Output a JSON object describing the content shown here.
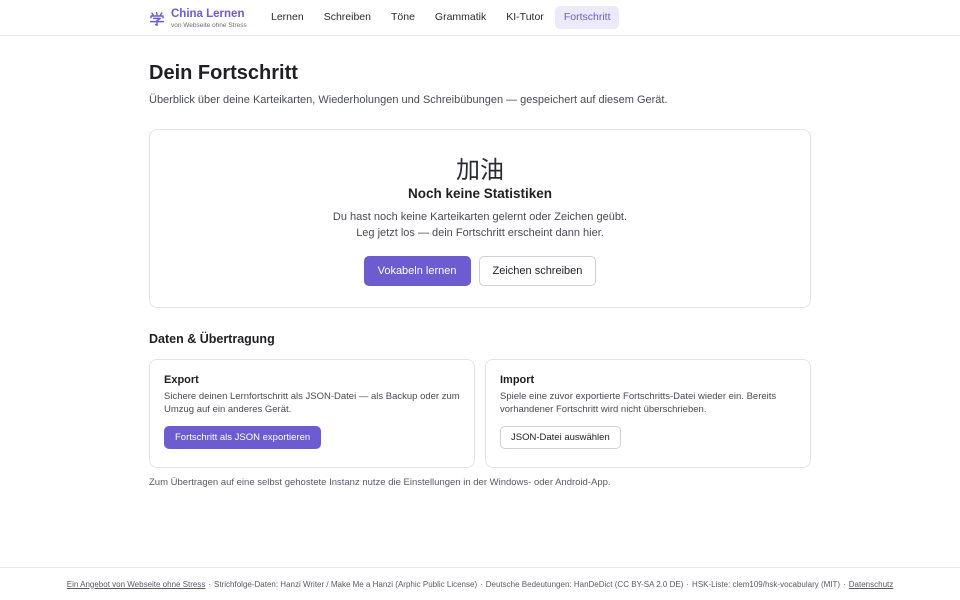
{
  "brand": {
    "icon": "xue-character-icon",
    "icon_glyph": "学",
    "title": "China Lernen",
    "subtitle": "von Webseite ohne Stress"
  },
  "nav": {
    "items": [
      {
        "label": "Lernen"
      },
      {
        "label": "Schreiben"
      },
      {
        "label": "Töne"
      },
      {
        "label": "Grammatik"
      },
      {
        "label": "KI-Tutor"
      },
      {
        "label": "Fortschritt"
      }
    ],
    "active": "Fortschritt"
  },
  "page": {
    "title": "Dein Fortschritt",
    "subtitle": "Überblick über deine Karteikarten, Wiederholungen und Schreibübungen — gespeichert auf diesem Gerät."
  },
  "empty_state": {
    "glyph": "加油",
    "title": "Noch keine Statistiken",
    "text_line1": "Du hast noch keine Karteikarten gelernt oder Zeichen geübt.",
    "text_line2": "Leg jetzt los — dein Fortschritt erscheint dann hier.",
    "primary_button": "Vokabeln lernen",
    "secondary_button": "Zeichen schreiben"
  },
  "data_section": {
    "title": "Daten & Übertragung",
    "export": {
      "title": "Export",
      "text": "Sichere deinen Lernfortschritt als JSON-Datei — als Backup oder zum Umzug auf ein anderes Gerät.",
      "button": "Fortschritt als JSON exportieren"
    },
    "import": {
      "title": "Import",
      "text": "Spiele eine zuvor exportierte Fortschritts-Datei wieder ein. Bereits vorhandener Fortschritt wird nicht überschrieben.",
      "button": "JSON-Datei auswählen"
    },
    "hint": "Zum Übertragen auf eine selbst gehostete Instanz nutze die Einstellungen in der Windows- oder Android-App."
  },
  "footer": {
    "offer_link": "Ein Angebot von Webseite ohne Stress",
    "separator": "·",
    "stroke_data": "Strichfolge-Daten: Hanzi Writer / Make Me a Hanzi (Arphic Public License)",
    "meanings": "Deutsche Bedeutungen: HanDeDict (CC BY-SA 2.0 DE)",
    "hsk_list": "HSK-Liste: clem109/hsk-vocabulary (MIT)",
    "privacy_link": "Datenschutz"
  },
  "colors": {
    "accent": "#6d5bd0",
    "accent_soft": "#ece9fb",
    "border": "#e3e3e8"
  }
}
